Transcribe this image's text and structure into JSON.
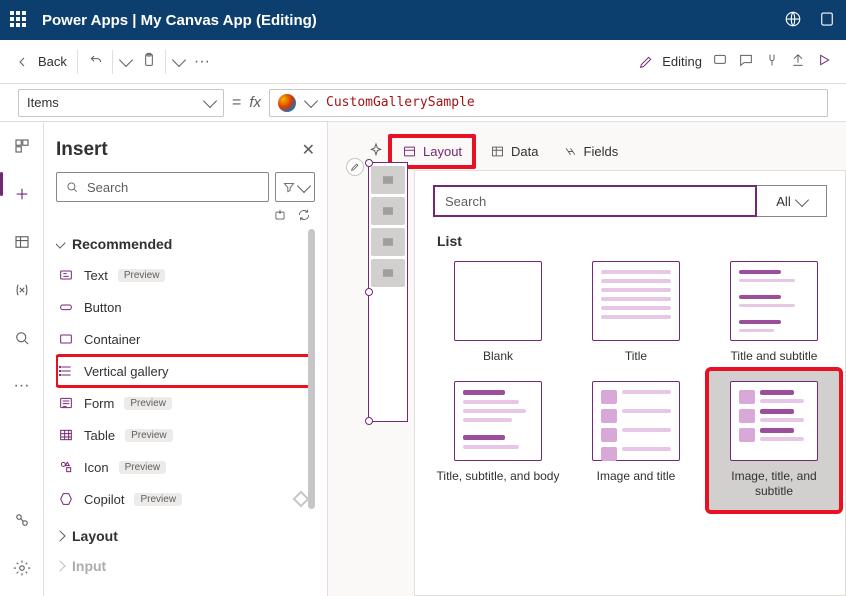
{
  "topbar": {
    "title": "Power Apps  |  My Canvas App (Editing)"
  },
  "cmdbar": {
    "back": "Back",
    "editing": "Editing"
  },
  "formula": {
    "property": "Items",
    "value": "CustomGallerySample"
  },
  "insert": {
    "title": "Insert",
    "search_placeholder": "Search",
    "section": "Recommended",
    "items": [
      {
        "label": "Text",
        "preview": true
      },
      {
        "label": "Button",
        "preview": false
      },
      {
        "label": "Container",
        "preview": false
      },
      {
        "label": "Vertical gallery",
        "preview": false,
        "highlight": true
      },
      {
        "label": "Form",
        "preview": true
      },
      {
        "label": "Table",
        "preview": true
      },
      {
        "label": "Icon",
        "preview": true
      },
      {
        "label": "Copilot",
        "preview": true,
        "diamond": true
      }
    ],
    "section2": "Layout",
    "section3": "Input"
  },
  "ctx": {
    "tabs": {
      "layout": "Layout",
      "data": "Data",
      "fields": "Fields"
    }
  },
  "flyout": {
    "search_placeholder": "Search",
    "filter": "All",
    "section": "List",
    "cards": [
      "Blank",
      "Title",
      "Title and subtitle",
      "Title, subtitle, and body",
      "Image and title",
      "Image, title, and subtitle"
    ]
  }
}
